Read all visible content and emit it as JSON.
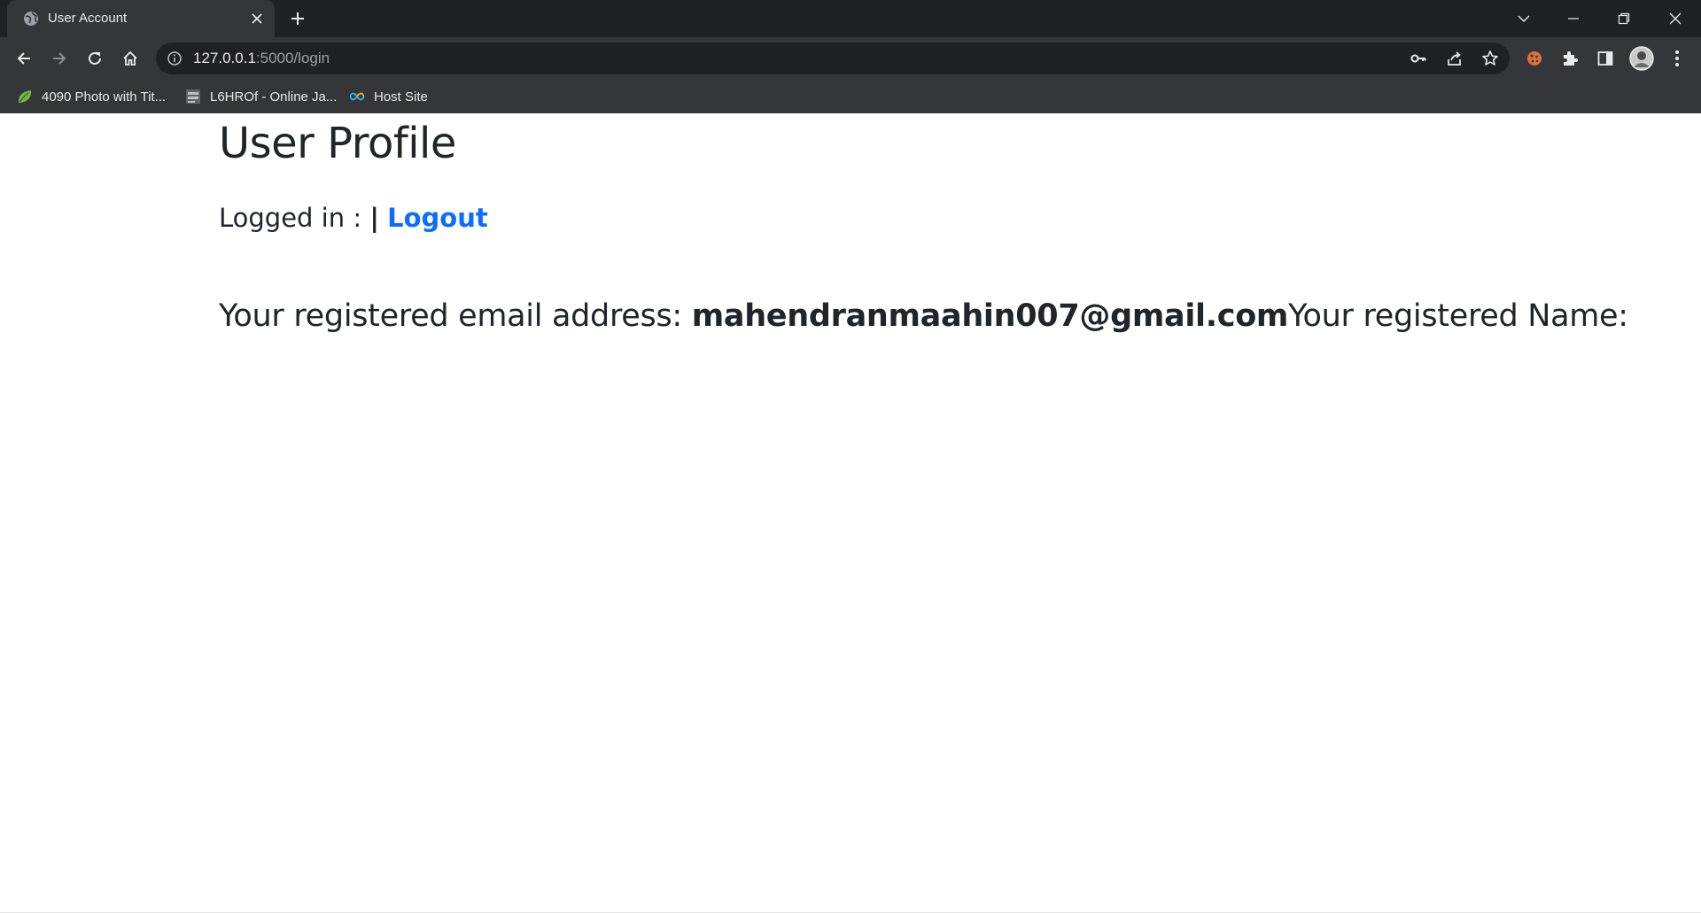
{
  "browser": {
    "tab": {
      "title": "User Account"
    },
    "address_bar": {
      "host": "127.0.0.1",
      "rest": ":5000/login"
    },
    "bookmarks": [
      {
        "label": "4090 Photo with Tit..."
      },
      {
        "label": "L6HROf - Online Ja..."
      },
      {
        "label": "Host Site"
      }
    ]
  },
  "page": {
    "title": "User Profile",
    "logged_in_label": "Logged in : ",
    "separator": "|",
    "logout_label": "Logout",
    "email_label": "Your registered email address: ",
    "email_value": "mahendranmaahin007@gmail.com",
    "name_label": "Your registered Name:"
  },
  "colors": {
    "link": "#0d6efd",
    "chrome_dark": "#202124",
    "chrome_toolbar": "#35363a"
  }
}
